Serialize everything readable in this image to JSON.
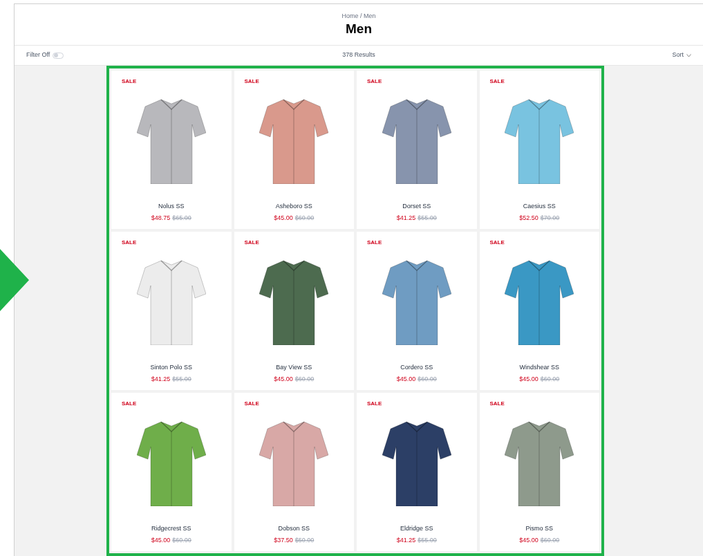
{
  "breadcrumb": "Home / Men",
  "title": "Men",
  "toolbar": {
    "filter_label": "Filter Off",
    "filter_on": false,
    "results": "378 Results",
    "sort_label": "Sort"
  },
  "products": [
    {
      "badge": "SALE",
      "name": "Nolus SS",
      "price": "$48.75",
      "original_price": "$65.00",
      "color": "#b8b8bc"
    },
    {
      "badge": "SALE",
      "name": "Asheboro SS",
      "price": "$45.00",
      "original_price": "$60.00",
      "color": "#d9998c"
    },
    {
      "badge": "SALE",
      "name": "Dorset SS",
      "price": "$41.25",
      "original_price": "$55.00",
      "color": "#8794ad"
    },
    {
      "badge": "SALE",
      "name": "Caesius SS",
      "price": "$52.50",
      "original_price": "$70.00",
      "color": "#79c3e0"
    },
    {
      "badge": "SALE",
      "name": "Sinton Polo SS",
      "price": "$41.25",
      "original_price": "$55.00",
      "color": "#ececec"
    },
    {
      "badge": "SALE",
      "name": "Bay View SS",
      "price": "$45.00",
      "original_price": "$60.00",
      "color": "#4d6b4f"
    },
    {
      "badge": "SALE",
      "name": "Cordero SS",
      "price": "$45.00",
      "original_price": "$60.00",
      "color": "#6f9cc2"
    },
    {
      "badge": "SALE",
      "name": "Windshear SS",
      "price": "$45.00",
      "original_price": "$60.00",
      "color": "#3a98c4"
    },
    {
      "badge": "SALE",
      "name": "Ridgecrest SS",
      "price": "$45.00",
      "original_price": "$60.00",
      "color": "#6fae4a"
    },
    {
      "badge": "SALE",
      "name": "Dobson SS",
      "price": "$37.50",
      "original_price": "$50.00",
      "color": "#d8a8a6"
    },
    {
      "badge": "SALE",
      "name": "Eldridge SS",
      "price": "$41.25",
      "original_price": "$55.00",
      "color": "#2c3f66"
    },
    {
      "badge": "SALE",
      "name": "Pismo SS",
      "price": "$45.00",
      "original_price": "$60.00",
      "color": "#8e9a8c"
    }
  ]
}
